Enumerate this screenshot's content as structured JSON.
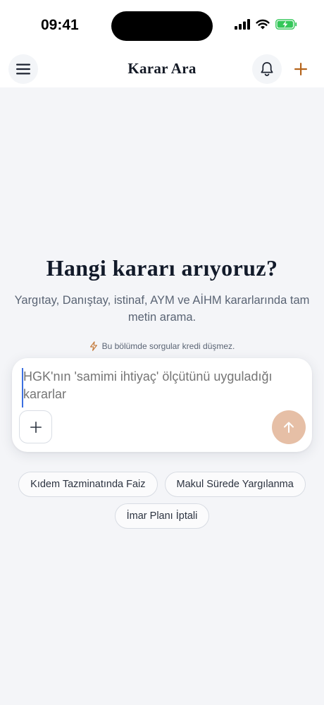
{
  "status_bar": {
    "time": "09:41",
    "icons": [
      "signal-icon",
      "wifi-icon",
      "battery-charging-icon"
    ],
    "battery_color": "#34c759"
  },
  "app_bar": {
    "title": "Karar Ara",
    "left_icon": "menu-icon",
    "right_icons": [
      "bell-icon",
      "plus-icon"
    ],
    "accent_color": "#b5651d"
  },
  "hero": {
    "title": "Hangi kararı arıyoruz?",
    "subtitle": "Yargıtay, Danıştay, istinaf, AYM ve AİHM kararlarında tam metin arama.",
    "credit_note": "Bu bölümde sorgular kredi düşmez.",
    "credit_icon": "lightning-icon"
  },
  "search": {
    "placeholder": "HGK'nın 'samimi ihtiyaç' ölçütünü uyguladığı kararlar",
    "value": "",
    "attach_icon": "plus-icon",
    "send_icon": "arrow-up-icon",
    "send_color": "#e6bfa6"
  },
  "suggestions": [
    {
      "label": "Kıdem Tazminatında Faiz"
    },
    {
      "label": "Makul Sürede Yargılanma"
    },
    {
      "label": "İmar Planı İptali"
    }
  ]
}
